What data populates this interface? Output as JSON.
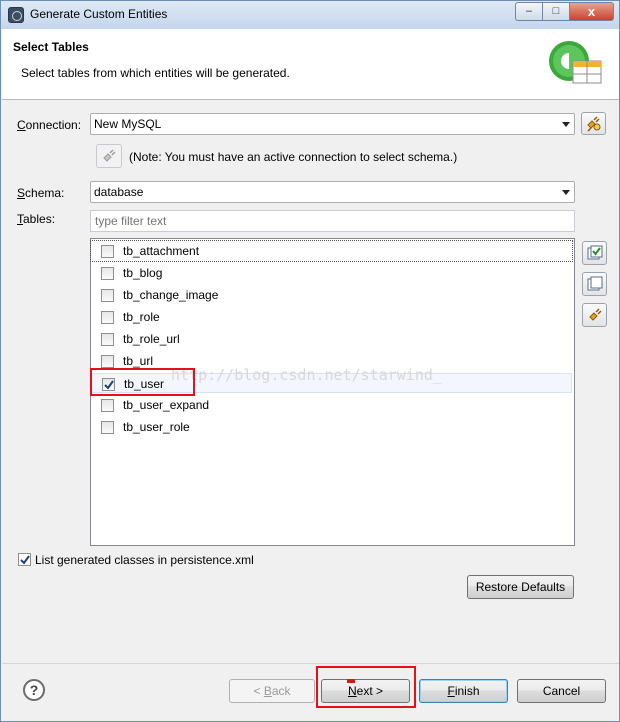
{
  "window": {
    "title": "Generate Custom Entities",
    "minimize_label": "–",
    "maximize_label": "□",
    "close_label": "x"
  },
  "header": {
    "title": "Select Tables",
    "description": "Select tables from which entities will be generated."
  },
  "connection": {
    "label_pre": "C",
    "label_post": "onnection:",
    "value": "New MySQL",
    "note": "(Note: You must have an active connection to select schema.)"
  },
  "schema": {
    "label_pre": "S",
    "label_post": "chema:",
    "value": "database"
  },
  "tables": {
    "label_pre": "T",
    "label_post": "ables:",
    "filter_placeholder": "type filter text",
    "items": [
      {
        "name": "tb_attachment",
        "checked": false
      },
      {
        "name": "tb_blog",
        "checked": false
      },
      {
        "name": "tb_change_image",
        "checked": false
      },
      {
        "name": "tb_role",
        "checked": false
      },
      {
        "name": "tb_role_url",
        "checked": false
      },
      {
        "name": "tb_url",
        "checked": false
      },
      {
        "name": "tb_user",
        "checked": true
      },
      {
        "name": "tb_user_expand",
        "checked": false
      },
      {
        "name": "tb_user_role",
        "checked": false
      }
    ]
  },
  "watermark": "http://blog.csdn.net/starwind_",
  "persistence": {
    "label": "List generated classes in persistence.xml",
    "checked": true
  },
  "buttons": {
    "restore_defaults": "Restore Defaults",
    "back_pre": "< ",
    "back_u": "B",
    "back_post": "ack",
    "next_u": "N",
    "next_post": "ext >",
    "finish_u": "F",
    "finish_post": "inish",
    "cancel": "Cancel",
    "help": "?"
  },
  "colors": {
    "highlight_red": "#e0121b",
    "title_bar": "#c4d6ec"
  }
}
